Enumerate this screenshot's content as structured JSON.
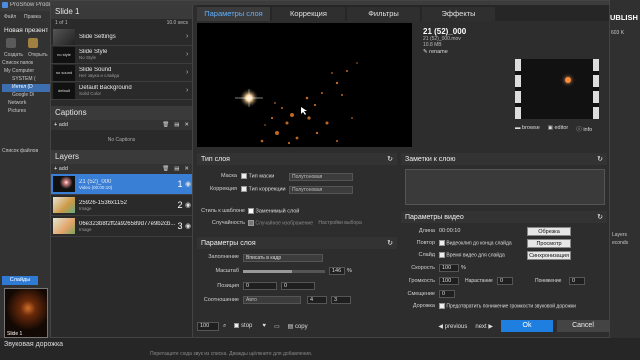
{
  "background_app": {
    "title": "ProShow Produ",
    "menu": [
      "Файл",
      "Правка"
    ],
    "new_presentation": "Новая презент",
    "buttons": [
      "Создать",
      "Открыть"
    ],
    "folder_list_label": "Список папок",
    "tree": [
      "My Computer",
      "SYSTEM (",
      "Интел (D",
      "Google Di",
      "Network",
      "Pictures"
    ],
    "file_list_label": "Список файлов",
    "slides_tab": "Слайды",
    "slide_label": "Slide 1",
    "slide_number": "1",
    "audio_track": "Звуковая дорожка",
    "status_hint": "Перетащите сюда звук из списка. Дважды щёлкните для добавления.",
    "right_title": "UBLISH",
    "right_text": [
      "Layers",
      "econds"
    ],
    "right_value": "603 K"
  },
  "left_panel": {
    "slide_title": "Slide 1",
    "counter": "1 of 1",
    "duration": "10.0 secs",
    "items": [
      {
        "title": "Slide Settings",
        "sub": ""
      },
      {
        "title": "Slide Style",
        "sub": "No Style",
        "thumb": "no style"
      },
      {
        "title": "Slide Sound",
        "sub": "Нет звука и слайда",
        "thumb": "no sound"
      },
      {
        "title": "Default Background",
        "sub": "Solid Color",
        "thumb": "default"
      }
    ],
    "captions_header": "Captions",
    "add_label": "add",
    "no_captions": "No Captions",
    "layers_header": "Layers",
    "layers": [
      {
        "name": "21 (52)_000",
        "sub": "Video (00:00:10)",
        "num": "1"
      },
      {
        "name": "25926-1536x1152",
        "sub": "Image",
        "num": "2"
      },
      {
        "name": "06e323b8f2ff2a926589d77e9b2cb...",
        "sub": "Image",
        "num": "3"
      }
    ]
  },
  "tabs": [
    "Параметры слоя",
    "Коррекция",
    "Фильтры",
    "Эффекты"
  ],
  "file_info": {
    "name": "21 (52)_000",
    "file": "21 (52)_000.mov",
    "size": "10.8 MB",
    "rename": "rename",
    "actions": [
      "browse",
      "editor",
      "info"
    ]
  },
  "layer_type": {
    "header": "Тип слоя",
    "mask_label": "Маска",
    "mask_check": "Тип маски",
    "mask_combo": "Полутоновая",
    "correction_label": "Коррекция",
    "correction_check": "Тип коррекции",
    "correction_combo": "Полутоновая",
    "style_label": "Стиль к шаблоне",
    "style_check": "Заменимый слой",
    "random_label": "Случайность",
    "random_check": "Случайное изображение",
    "random_extra": "Настройки выбора"
  },
  "layer_params": {
    "header": "Параметры слоя",
    "fill_label": "Заполнение",
    "fill_value": "Вписать в кадр",
    "scale_label": "Масштаб",
    "scale_value": "146",
    "scale_unit": "%",
    "position_label": "Позиция",
    "pos_x": "0",
    "pos_y": "0",
    "ratio_label": "Соотношение",
    "ratio_value": "Авто",
    "ratio_a": "4",
    "ratio_b": "3"
  },
  "notes": {
    "header": "Заметки к слою"
  },
  "video_params": {
    "header": "Параметры видео",
    "length_label": "Длина",
    "length_value": "00:00:10",
    "trim_button": "Обрезка",
    "repeat_label": "Повтор",
    "repeat_check": "Видеоклип до конца слайда",
    "preview_button": "Просмотр",
    "slide_label": "Слайд",
    "slide_check": "Время видео для слайда",
    "sync_button": "Синхронизация",
    "speed_label": "Скорость",
    "speed_value": "100",
    "speed_unit": "%",
    "volume_label": "Громкость",
    "volume_value": "100",
    "fadein_label": "Нарастание",
    "fadein_value": "0",
    "fadeout_label": "Понижение",
    "fadeout_value": "0",
    "offset_label": "Смещение",
    "offset_value": "0",
    "track_label": "Дорожка",
    "track_check": "Предотвратить понижение громкости звуковой дорожки"
  },
  "footer": {
    "zoom": "100",
    "stop": "stop",
    "copy": "copy",
    "previous": "previous",
    "next": "next",
    "ok": "Ok",
    "cancel": "Cancel"
  }
}
